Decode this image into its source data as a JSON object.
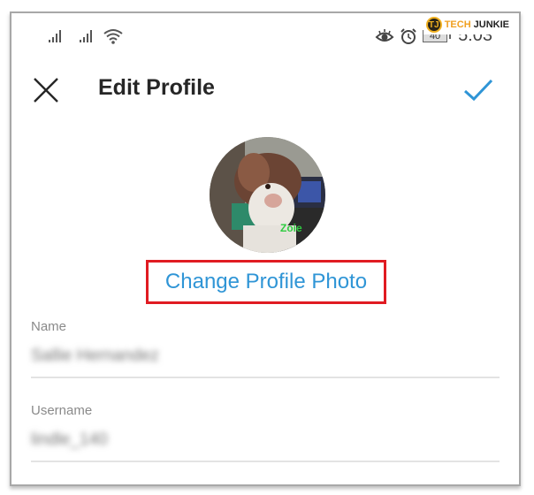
{
  "watermark": {
    "logo_letter": "TJ",
    "text_part1": "TECH",
    "text_part2": "JUNKIE"
  },
  "status_bar": {
    "icons": [
      "signal-icon",
      "signal-icon",
      "wifi-icon",
      "eye-comfort-icon",
      "alarm-icon",
      "battery-icon"
    ],
    "battery_level": "40",
    "time": "5:03"
  },
  "header": {
    "close_icon": "close-icon",
    "title": "Edit Profile",
    "confirm_icon": "checkmark-icon",
    "accent_color": "#2f95d6"
  },
  "profile": {
    "photo_caption": "Zoie",
    "change_photo_label": "Change Profile Photo",
    "highlight_color": "#e01b22"
  },
  "fields": [
    {
      "label": "Name",
      "value": "Sallie Hernandez"
    },
    {
      "label": "Username",
      "value": "lindle_140"
    }
  ]
}
